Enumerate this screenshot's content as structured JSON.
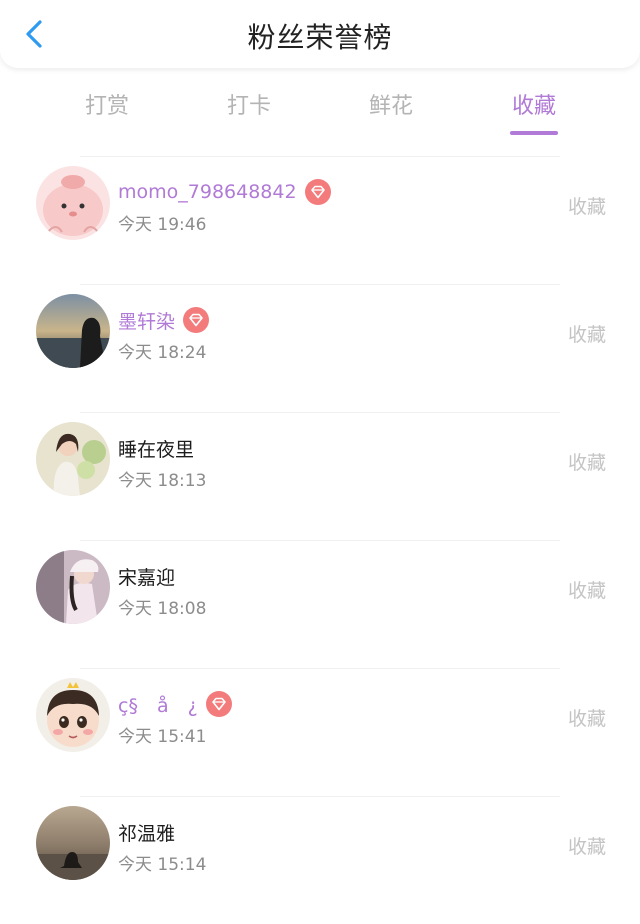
{
  "header": {
    "title": "粉丝荣誉榜"
  },
  "tabs": [
    {
      "label": "打赏"
    },
    {
      "label": "打卡"
    },
    {
      "label": "鲜花"
    },
    {
      "label": "收藏"
    }
  ],
  "active_tab": "收藏",
  "colors": {
    "accent": "#b07ad6",
    "badge": "#f37b7b",
    "back_arrow": "#2f9bf0"
  },
  "fans": [
    {
      "name": "momo_798648842",
      "time": "今天 19:46",
      "action": "收藏",
      "badge": "diamond-badge-icon",
      "highlight": true
    },
    {
      "name": "墨轩染",
      "time": "今天 18:24",
      "action": "收藏",
      "badge": "diamond-badge-icon",
      "highlight": true
    },
    {
      "name": "睡在夜里",
      "time": "今天 18:13",
      "action": "收藏",
      "badge": null,
      "highlight": false
    },
    {
      "name": "宋嘉迎",
      "time": "今天 18:08",
      "action": "收藏",
      "badge": null,
      "highlight": false
    },
    {
      "name": "ç§　å　¿",
      "time": "今天 15:41",
      "action": "收藏",
      "badge": "diamond-badge-icon",
      "highlight": true
    },
    {
      "name": "祁温雅",
      "time": "今天 15:14",
      "action": "收藏",
      "badge": null,
      "highlight": false
    }
  ]
}
